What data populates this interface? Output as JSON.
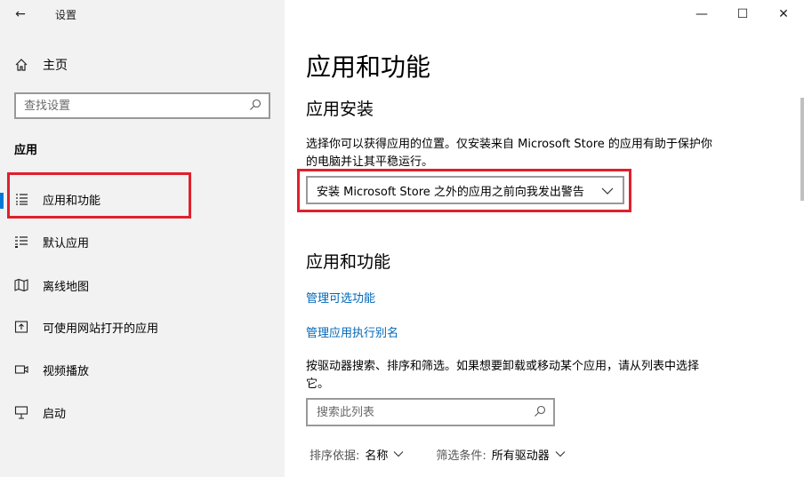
{
  "window": {
    "title": "设置",
    "controls": {
      "minimize": "—",
      "maximize": "☐",
      "close": "✕"
    }
  },
  "sidebar": {
    "back_glyph": "←",
    "home_label": "主页",
    "search_placeholder": "查找设置",
    "section_heading": "应用",
    "items": [
      {
        "label": "应用和功能",
        "icon": "list-icon",
        "selected": true
      },
      {
        "label": "默认应用",
        "icon": "default-apps-icon",
        "selected": false
      },
      {
        "label": "离线地图",
        "icon": "map-icon",
        "selected": false
      },
      {
        "label": "可使用网站打开的应用",
        "icon": "open-web-icon",
        "selected": false
      },
      {
        "label": "视频播放",
        "icon": "video-icon",
        "selected": false
      },
      {
        "label": "启动",
        "icon": "startup-icon",
        "selected": false
      }
    ]
  },
  "main": {
    "page_title": "应用和功能",
    "install_heading": "应用安装",
    "install_desc": "选择你可以获得应用的位置。仅安装来自 Microsoft Store 的应用有助于保护你的电脑并让其平稳运行。",
    "install_dropdown_value": "安装 Microsoft Store 之外的应用之前向我发出警告",
    "apps_heading": "应用和功能",
    "link_optional_features": "管理可选功能",
    "link_alias": "管理应用执行别名",
    "apps_desc": "按驱动器搜索、排序和筛选。如果想要卸载或移动某个应用，请从列表中选择它。",
    "list_search_placeholder": "搜索此列表",
    "sort_label": "排序依据:",
    "sort_value": "名称",
    "filter_label": "筛选条件:",
    "filter_value": "所有驱动器"
  },
  "colors": {
    "accent": "#0078d7",
    "link": "#0067b8",
    "highlight_box": "#e0202c",
    "sidebar_bg": "#f2f2f2"
  }
}
